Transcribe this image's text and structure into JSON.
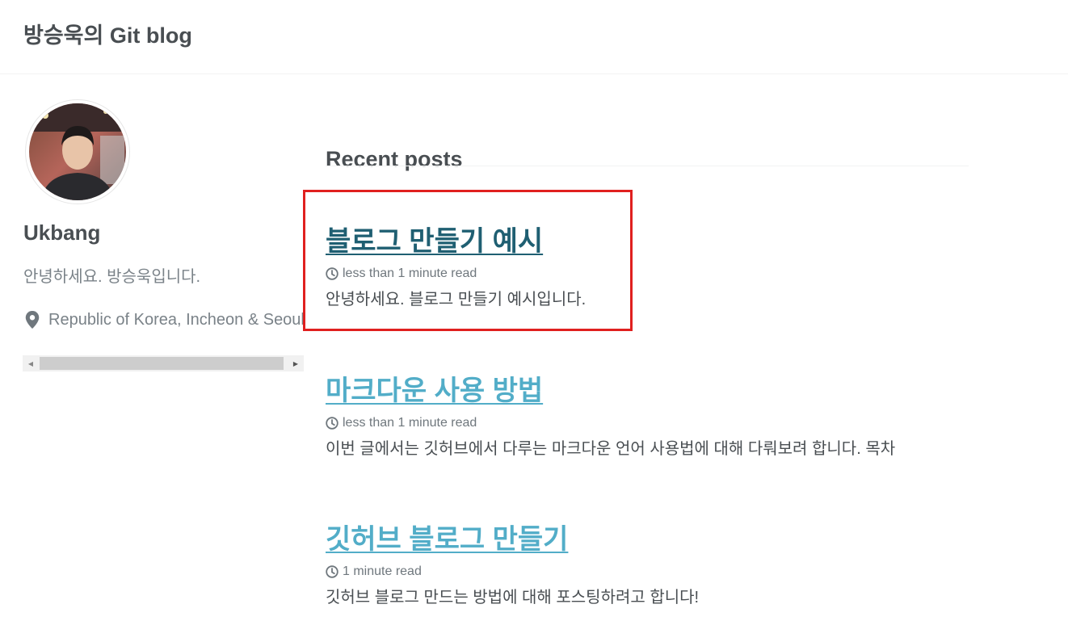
{
  "site": {
    "title": "방승욱의 Git blog"
  },
  "author": {
    "name": "Ukbang",
    "bio": "안녕하세요. 방승욱입니다.",
    "location": "Republic of Korea, Incheon & Seoul"
  },
  "main": {
    "section_title": "Recent posts",
    "posts": [
      {
        "title": "블로그 만들기 예시",
        "read_time": "less than 1 minute read",
        "excerpt": "안녕하세요. 블로그 만들기 예시입니다."
      },
      {
        "title": "마크다운 사용 방법",
        "read_time": "less than 1 minute read",
        "excerpt": "이번 글에서는 깃허브에서 다루는 마크다운 언어 사용법에 대해 다뤄보려 합니다. 목차"
      },
      {
        "title": "깃허브 블로그 만들기",
        "read_time": "1 minute read",
        "excerpt": "깃허브 블로그 만드는 방법에 대해 포스팅하려고 합니다!"
      }
    ]
  },
  "icons": {
    "location": "map-marker-icon",
    "read_time": "clock-icon",
    "scroll_left": "arrow-left-icon",
    "scroll_right": "arrow-right-icon"
  },
  "colors": {
    "link": "#52adc8",
    "link_active": "#1f5f72",
    "highlight": "#e0201f",
    "text": "#494e52",
    "muted": "#7a8288"
  }
}
